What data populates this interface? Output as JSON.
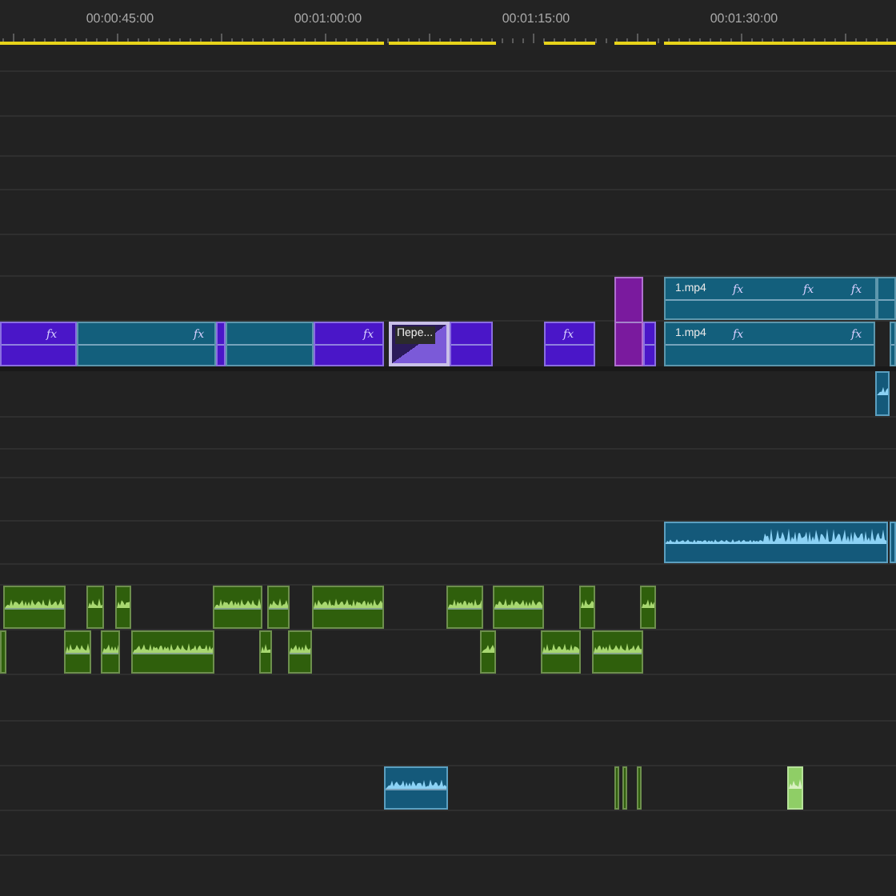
{
  "ruler": {
    "timecodes": [
      "00:00:45:00",
      "00:01:00:00",
      "00:01:15:00",
      "00:01:30:00"
    ]
  },
  "clips": [
    {
      "kind": "video-purple",
      "badges": [
        "fx"
      ]
    },
    {
      "kind": "video-teal",
      "badges": [
        "fx"
      ]
    },
    {
      "kind": "video-purple"
    },
    {
      "kind": "video-teal"
    },
    {
      "kind": "video-purple",
      "badges": [
        "fx"
      ]
    },
    {
      "kind": "transition",
      "label": "Пере..."
    },
    {
      "kind": "video-purple"
    },
    {
      "kind": "video-purple",
      "badges": [
        "fx"
      ]
    },
    {
      "kind": "video-magenta"
    },
    {
      "kind": "video-purple"
    },
    {
      "kind": "video-teal",
      "label": "1.mp4",
      "badges": [
        "fx",
        "fx",
        "fx"
      ]
    },
    {
      "kind": "video-teal"
    },
    {
      "kind": "video-teal",
      "label": "1.mp4",
      "badges": [
        "fx",
        "fx"
      ]
    },
    {
      "kind": "video-teal"
    },
    {
      "kind": "audio-blue"
    },
    {
      "kind": "audio-blue"
    },
    {
      "kind": "audio-blue"
    },
    {
      "kind": "audio-green"
    },
    {
      "kind": "audio-green"
    },
    {
      "kind": "audio-green"
    },
    {
      "kind": "audio-green"
    },
    {
      "kind": "audio-green"
    },
    {
      "kind": "audio-green"
    },
    {
      "kind": "audio-green"
    },
    {
      "kind": "audio-green"
    },
    {
      "kind": "audio-green"
    },
    {
      "kind": "audio-green"
    },
    {
      "kind": "audio-green"
    },
    {
      "kind": "audio-green"
    },
    {
      "kind": "audio-green"
    },
    {
      "kind": "audio-green"
    },
    {
      "kind": "audio-green"
    },
    {
      "kind": "audio-green"
    },
    {
      "kind": "audio-green"
    },
    {
      "kind": "audio-green"
    },
    {
      "kind": "audio-green"
    },
    {
      "kind": "audio-blue"
    },
    {
      "kind": "audio-green"
    },
    {
      "kind": "audio-green"
    },
    {
      "kind": "audio-green"
    },
    {
      "kind": "audio-light"
    }
  ]
}
